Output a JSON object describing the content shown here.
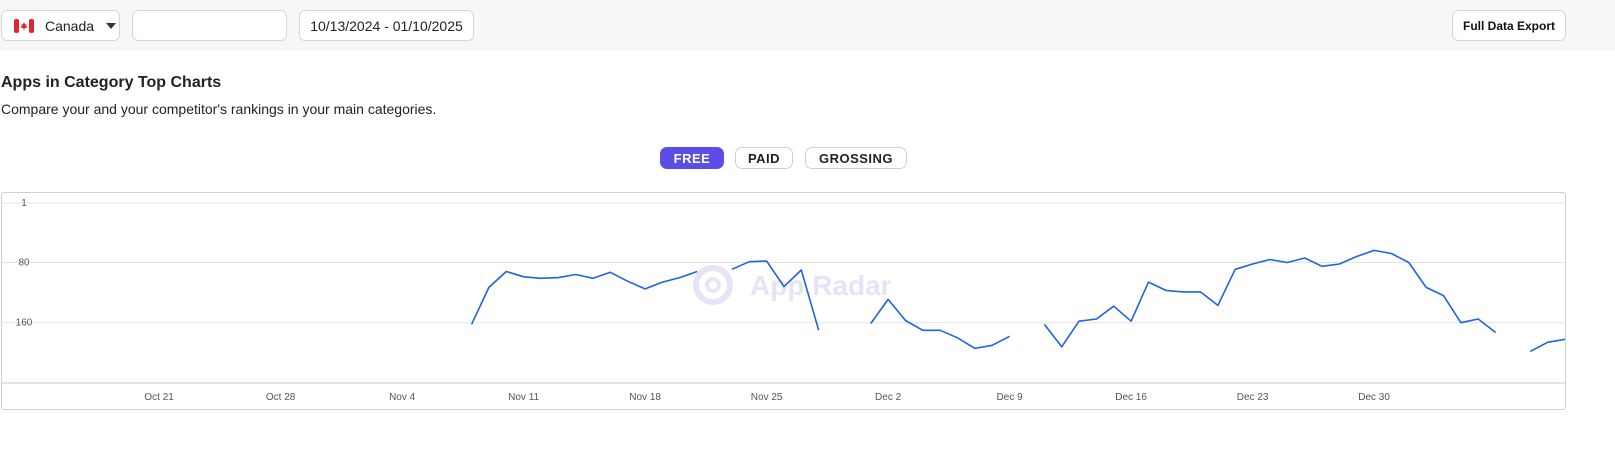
{
  "toolbar": {
    "country": "Canada",
    "search_value": "",
    "date_range": "10/13/2024 - 01/10/2025",
    "export_label": "Full Data Export"
  },
  "section": {
    "title": "Apps in Category Top Charts",
    "subtitle": "Compare your and your competitor's rankings in your main categories."
  },
  "tabs": [
    {
      "label": "FREE",
      "active": true
    },
    {
      "label": "PAID",
      "active": false
    },
    {
      "label": "GROSSING",
      "active": false
    }
  ],
  "watermark": "App Radar",
  "colors": {
    "accent": "#5b4de6",
    "line": "#1f63e0",
    "flag_red": "#e0262b"
  },
  "chart_data": {
    "type": "line",
    "y_axis": {
      "ticks": [
        "1",
        "80",
        "160"
      ],
      "reversed": true,
      "ylim": [
        1,
        240
      ]
    },
    "x_axis": {
      "start": "Oct 13",
      "ticks": [
        {
          "label": "Oct 21",
          "day": 8
        },
        {
          "label": "Oct 28",
          "day": 15
        },
        {
          "label": "Nov 4",
          "day": 22
        },
        {
          "label": "Nov 11",
          "day": 29
        },
        {
          "label": "Nov 18",
          "day": 36
        },
        {
          "label": "Nov 25",
          "day": 43
        },
        {
          "label": "Dec 2",
          "day": 50
        },
        {
          "label": "Dec 9",
          "day": 57
        },
        {
          "label": "Dec 16",
          "day": 64
        },
        {
          "label": "Dec 23",
          "day": 71
        },
        {
          "label": "Dec 30",
          "day": 78
        }
      ],
      "xlim": [
        0,
        89
      ]
    },
    "grid": true,
    "segments": [
      [
        [
          26,
          162
        ],
        [
          27,
          113
        ],
        [
          28,
          92
        ],
        [
          29,
          99
        ],
        [
          30,
          101
        ],
        [
          31,
          100
        ],
        [
          32,
          96
        ],
        [
          33,
          101
        ],
        [
          34,
          93
        ],
        [
          35,
          105
        ],
        [
          36,
          115
        ],
        [
          37,
          106
        ],
        [
          38,
          100
        ],
        [
          39,
          92
        ]
      ],
      [
        [
          41,
          89
        ],
        [
          42,
          79
        ],
        [
          43,
          78
        ],
        [
          44,
          112
        ],
        [
          45,
          90
        ],
        [
          46,
          170
        ]
      ],
      [
        [
          49,
          161
        ],
        [
          50,
          129
        ],
        [
          51,
          157
        ],
        [
          52,
          170
        ],
        [
          53,
          170
        ],
        [
          54,
          180
        ],
        [
          55,
          194
        ],
        [
          56,
          190
        ],
        [
          57,
          178
        ]
      ],
      [
        [
          59,
          162
        ],
        [
          60,
          192
        ],
        [
          61,
          158
        ],
        [
          62,
          155
        ],
        [
          63,
          138
        ],
        [
          64,
          158
        ],
        [
          65,
          106
        ],
        [
          66,
          117
        ],
        [
          67,
          119
        ],
        [
          68,
          119
        ],
        [
          69,
          137
        ],
        [
          70,
          89
        ],
        [
          71,
          82
        ],
        [
          72,
          76
        ],
        [
          73,
          80
        ],
        [
          74,
          74
        ],
        [
          75,
          85
        ],
        [
          76,
          82
        ],
        [
          77,
          72
        ],
        [
          78,
          64
        ],
        [
          79,
          68
        ],
        [
          80,
          80
        ],
        [
          81,
          113
        ],
        [
          82,
          124
        ],
        [
          83,
          160
        ],
        [
          84,
          155
        ],
        [
          85,
          173
        ]
      ],
      [
        [
          87,
          198
        ],
        [
          88,
          186
        ],
        [
          89,
          182
        ]
      ]
    ]
  }
}
